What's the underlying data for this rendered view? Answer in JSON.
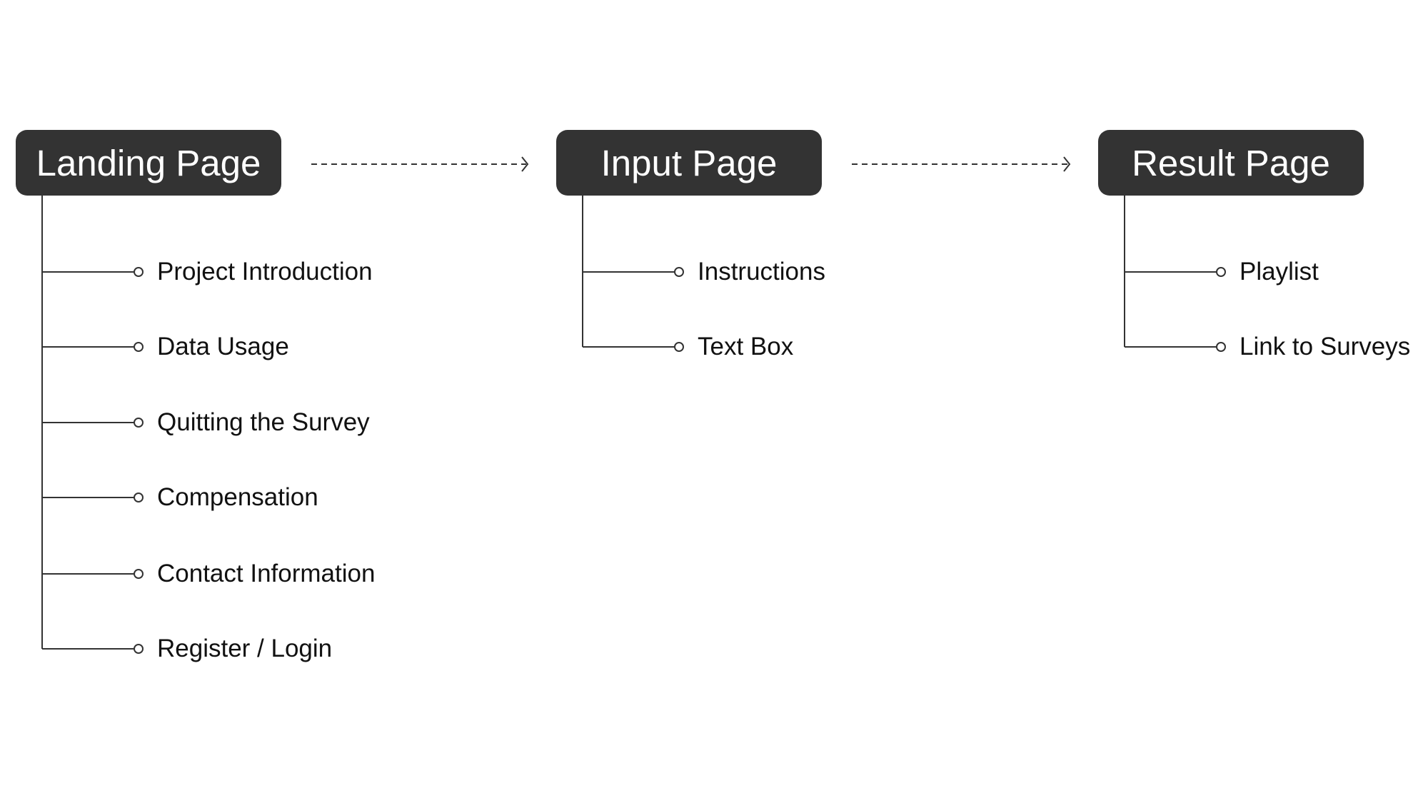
{
  "columns": [
    {
      "title": "Landing Page",
      "items": [
        "Project Introduction",
        "Data Usage",
        "Quitting the Survey",
        "Compensation",
        "Contact Information",
        "Register / Login"
      ]
    },
    {
      "title": "Input Page",
      "items": [
        "Instructions",
        "Text Box"
      ]
    },
    {
      "title": "Result Page",
      "items": [
        "Playlist",
        "Link to Surveys"
      ]
    }
  ],
  "colors": {
    "node_fill": "#333333",
    "line": "#333333"
  }
}
